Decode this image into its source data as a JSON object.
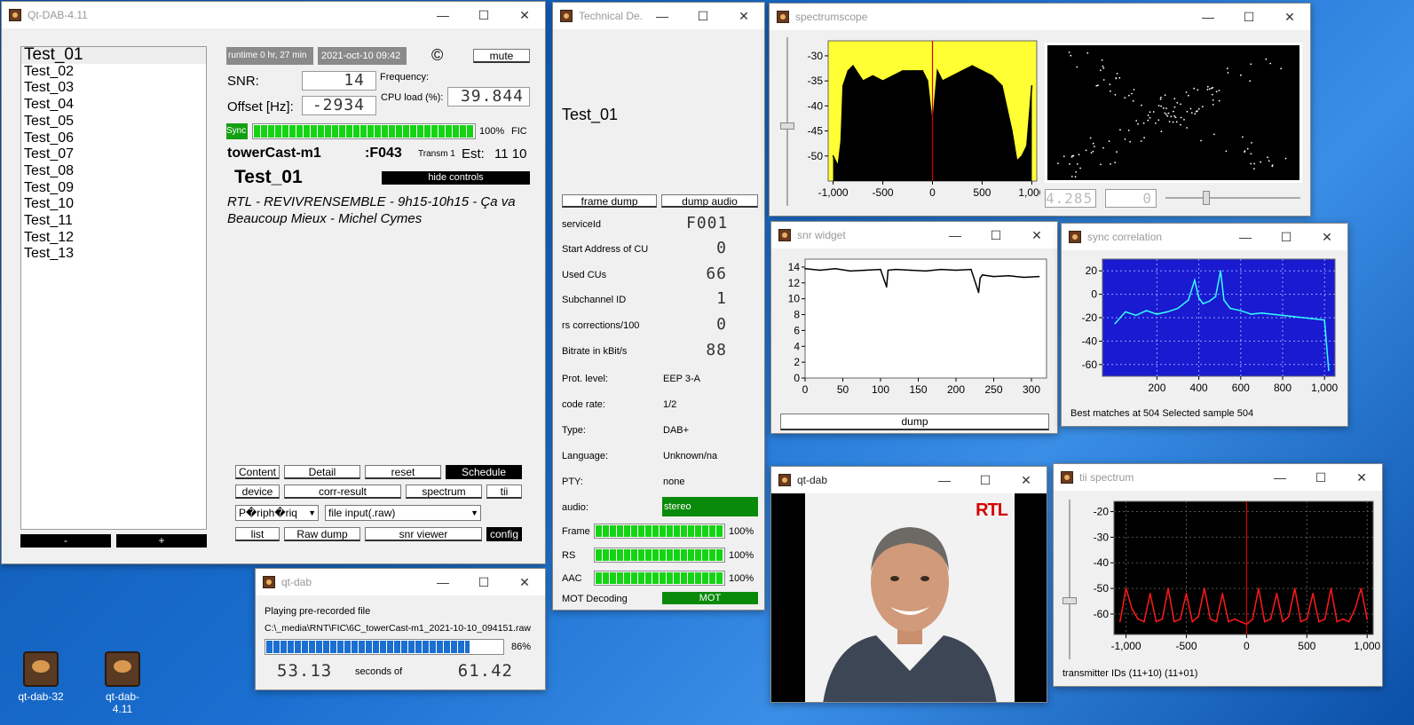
{
  "main": {
    "title": "Qt-DAB-4.11",
    "services": [
      "Test_01",
      "Test_02",
      "Test_03",
      "Test_04",
      "Test_05",
      "Test_06",
      "Test_07",
      "Test_08",
      "Test_09",
      "Test_10",
      "Test_11",
      "Test_12",
      "Test_13"
    ],
    "minus_label": "-",
    "plus_label": "+",
    "runtime": "runtime 0 hr, 27 min",
    "datetime": "2021-oct-10  09:42",
    "copyright": "©",
    "mute": "mute",
    "snr_label": "SNR:",
    "snr_value": "14",
    "frequency_label": "Frequency:",
    "offset_label": "Offset [Hz]:",
    "offset_value": "-2934",
    "cpu_label": "CPU load (%):",
    "cpu_value": "39.844",
    "sync_label": "Sync",
    "fic_quality": 1.0,
    "fic_percent": "100%",
    "fic_label": "FIC",
    "ensemble": "towerCast-m1",
    "ensemble_id": ":F043",
    "transm": "Transm 1",
    "est": "Est:",
    "est_value": "11 10",
    "service_name": "Test_01",
    "hide_controls": "hide controls",
    "dynamic_label": "RTL - REVIVRENSEMBLE - 9h15-10h15 - Ça va Beaucoup Mieux - Michel Cymes",
    "buttons": {
      "content": "Content",
      "detail": "Detail",
      "reset": "reset",
      "schedule": "Schedule",
      "device": "device",
      "corr_result": "corr-result",
      "spectrum": "spectrum",
      "tii": "tii",
      "list": "list",
      "raw_dump": "Raw dump",
      "snr_viewer": "snr viewer",
      "config": "config"
    },
    "preset_select": "P�riph�riq",
    "device_select": "file input(.raw)"
  },
  "tech": {
    "title": "Technical De...",
    "service": "Test_01",
    "frame_dump": "frame dump",
    "dump_audio": "dump audio",
    "service_id_label": "serviceId",
    "service_id": "F001",
    "start_cu_label": "Start Address of CU",
    "start_cu": "0",
    "used_cu_label": "Used CUs",
    "used_cu": "66",
    "subch_label": "Subchannel ID",
    "subch": "1",
    "rs_label": "rs corrections/100",
    "rs": "0",
    "bitrate_label": "Bitrate in kBit/s",
    "bitrate": "88",
    "prot_label": "Prot. level:",
    "prot": "EEP 3-A",
    "code_label": "code rate:",
    "code": "1/2",
    "type_label": "Type:",
    "type": "DAB+",
    "lang_label": "Language:",
    "lang": "Unknown/na",
    "pty_label": "PTY:",
    "pty": "none",
    "audio_label": "audio:",
    "audio": "stereo",
    "frame_label": "Frame",
    "frame_pct": "100%",
    "frame_level": 1.0,
    "rs_bar_label": "RS",
    "rs_pct": "100%",
    "rs_level": 1.0,
    "aac_label": "AAC",
    "aac_pct": "100%",
    "aac_level": 1.0,
    "mot_label": "MOT Decoding",
    "mot": "MOT",
    "accent_green": "#0a8a0a"
  },
  "spectrum": {
    "title": "spectrumscope",
    "lcd_left": "4.285",
    "lcd_right": "0"
  },
  "snr": {
    "title": "snr widget",
    "dump": "dump"
  },
  "sync": {
    "title": "sync correlation",
    "footer": "Best matches at 504 Selected sample 504"
  },
  "slide": {
    "title": "qt-dab",
    "logo": "RTL"
  },
  "tii": {
    "title": "tii spectrum",
    "footer": "transmitter IDs  (11+10) (11+01)"
  },
  "progress": {
    "title": "qt-dab",
    "line1": "Playing pre-recorded file",
    "path": "C:\\_media\\RNT\\FIC\\6C_towerCast-m1_2021-10-10_094151.raw",
    "percent": "86%",
    "fraction": 0.86,
    "elapsed": "53.13",
    "seconds_of": "seconds of",
    "total": "61.42"
  },
  "desktop": {
    "icon1": "qt-dab-32",
    "icon2": "qt-dab-4.11"
  },
  "chart_data": [
    {
      "type": "line",
      "name": "spectrumscope",
      "x": [
        -1000,
        -950,
        -920,
        -900,
        -850,
        -800,
        -700,
        -600,
        -500,
        -400,
        -300,
        -200,
        -100,
        -50,
        0,
        50,
        100,
        200,
        300,
        400,
        500,
        600,
        700,
        800,
        850,
        900,
        950,
        1000
      ],
      "y": [
        -50,
        -52,
        -47,
        -36,
        -33,
        -32,
        -35,
        -34,
        -35,
        -34,
        -33,
        -33,
        -33,
        -35,
        -44,
        -33,
        -35,
        -34,
        -33,
        -32,
        -33,
        -34,
        -36,
        -45,
        -51,
        -50,
        -48,
        -36
      ],
      "xticks": [
        "-1,000",
        "-500",
        "0",
        "500",
        "1,000"
      ],
      "yticks": [
        "-30",
        "-35",
        "-40",
        "-45",
        "-50"
      ],
      "xlim": [
        -1050,
        1050
      ],
      "ylim": [
        -55,
        -27
      ]
    },
    {
      "type": "line",
      "name": "snr",
      "x": [
        0,
        20,
        40,
        60,
        80,
        100,
        108,
        110,
        120,
        140,
        160,
        180,
        200,
        220,
        230,
        232,
        235,
        250,
        270,
        290,
        310
      ],
      "y": [
        13.8,
        13.6,
        13.8,
        13.5,
        13.6,
        13.7,
        11.5,
        13.6,
        13.7,
        13.6,
        13.5,
        13.7,
        13.6,
        13.7,
        10.8,
        12.6,
        13,
        12.8,
        12.9,
        12.7,
        12.8
      ],
      "xticks": [
        "0",
        "50",
        "100",
        "150",
        "200",
        "250",
        "300"
      ],
      "yticks": [
        "0",
        "2",
        "4",
        "6",
        "8",
        "10",
        "12",
        "14"
      ],
      "xlim": [
        0,
        320
      ],
      "ylim": [
        0,
        15
      ]
    },
    {
      "type": "line",
      "name": "sync correlation",
      "x": [
        0,
        50,
        100,
        150,
        200,
        250,
        300,
        350,
        380,
        400,
        420,
        450,
        480,
        504,
        520,
        550,
        600,
        650,
        700,
        800,
        900,
        1000,
        1020
      ],
      "y": [
        -25,
        -15,
        -18,
        -14,
        -17,
        -15,
        -12,
        -5,
        12,
        -3,
        -8,
        -6,
        -2,
        20,
        -5,
        -12,
        -14,
        -17,
        -16,
        -18,
        -20,
        -22,
        -65
      ],
      "xticks": [
        "200",
        "400",
        "600",
        "800",
        "1,000"
      ],
      "yticks": [
        "20",
        "0",
        "-20",
        "-40",
        "-60"
      ],
      "xlim": [
        -60,
        1050
      ],
      "ylim": [
        -70,
        30
      ]
    },
    {
      "type": "line",
      "name": "tii spectrum",
      "x": [
        -1050,
        -1000,
        -950,
        -900,
        -850,
        -800,
        -750,
        -700,
        -650,
        -600,
        -550,
        -500,
        -450,
        -400,
        -350,
        -300,
        -250,
        -200,
        -150,
        -100,
        -50,
        0,
        50,
        100,
        150,
        200,
        250,
        300,
        350,
        400,
        450,
        500,
        550,
        600,
        650,
        700,
        750,
        800,
        850,
        900,
        950,
        1000
      ],
      "y": [
        -63,
        -50,
        -58,
        -62,
        -63,
        -52,
        -63,
        -62,
        -50,
        -63,
        -62,
        -52,
        -63,
        -61,
        -50,
        -62,
        -63,
        -52,
        -63,
        -62,
        -63,
        -64,
        -62,
        -50,
        -63,
        -62,
        -52,
        -63,
        -61,
        -50,
        -63,
        -62,
        -52,
        -63,
        -62,
        -50,
        -63,
        -62,
        -63,
        -58,
        -50,
        -62
      ],
      "xticks": [
        "-1,000",
        "-500",
        "0",
        "500",
        "1,000"
      ],
      "yticks": [
        "-20",
        "-30",
        "-40",
        "-50",
        "-60"
      ],
      "xlim": [
        -1100,
        1050
      ],
      "ylim": [
        -68,
        -16
      ]
    }
  ]
}
